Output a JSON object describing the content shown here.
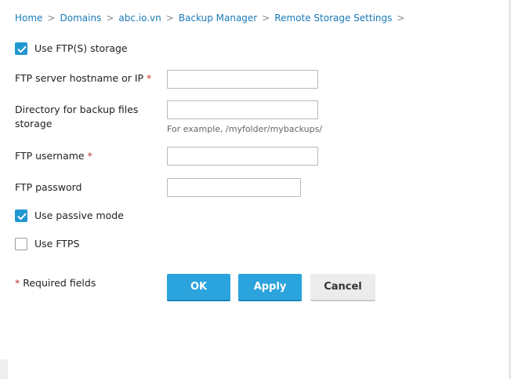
{
  "breadcrumb": {
    "items": [
      "Home",
      "Domains",
      "abc.io.vn",
      "Backup Manager",
      "Remote Storage Settings"
    ],
    "separator": ">"
  },
  "form": {
    "use_ftp_storage": {
      "label": "Use FTP(S) storage",
      "checked": true
    },
    "hostname": {
      "label": "FTP server hostname or IP",
      "required_mark": "*",
      "value": ""
    },
    "directory": {
      "label_line1": "Directory for backup files",
      "label_line2": "storage",
      "value": "",
      "hint": "For example, /myfolder/mybackups/"
    },
    "username": {
      "label": "FTP username",
      "required_mark": "*",
      "value": ""
    },
    "password": {
      "label": "FTP password",
      "value": ""
    },
    "passive_mode": {
      "label": "Use passive mode",
      "checked": true
    },
    "ftps": {
      "label": "Use FTPS",
      "checked": false
    },
    "required_note": {
      "mark": "*",
      "text": "Required fields"
    }
  },
  "buttons": {
    "ok": "OK",
    "apply": "Apply",
    "cancel": "Cancel"
  },
  "colors": {
    "link": "#1a7ab8",
    "accent": "#2197d2",
    "primary_button": "#2ba3dc",
    "required": "#c0392b"
  },
  "icons": {
    "checkmark": "check-icon",
    "chevron": "chevron-right-icon"
  }
}
